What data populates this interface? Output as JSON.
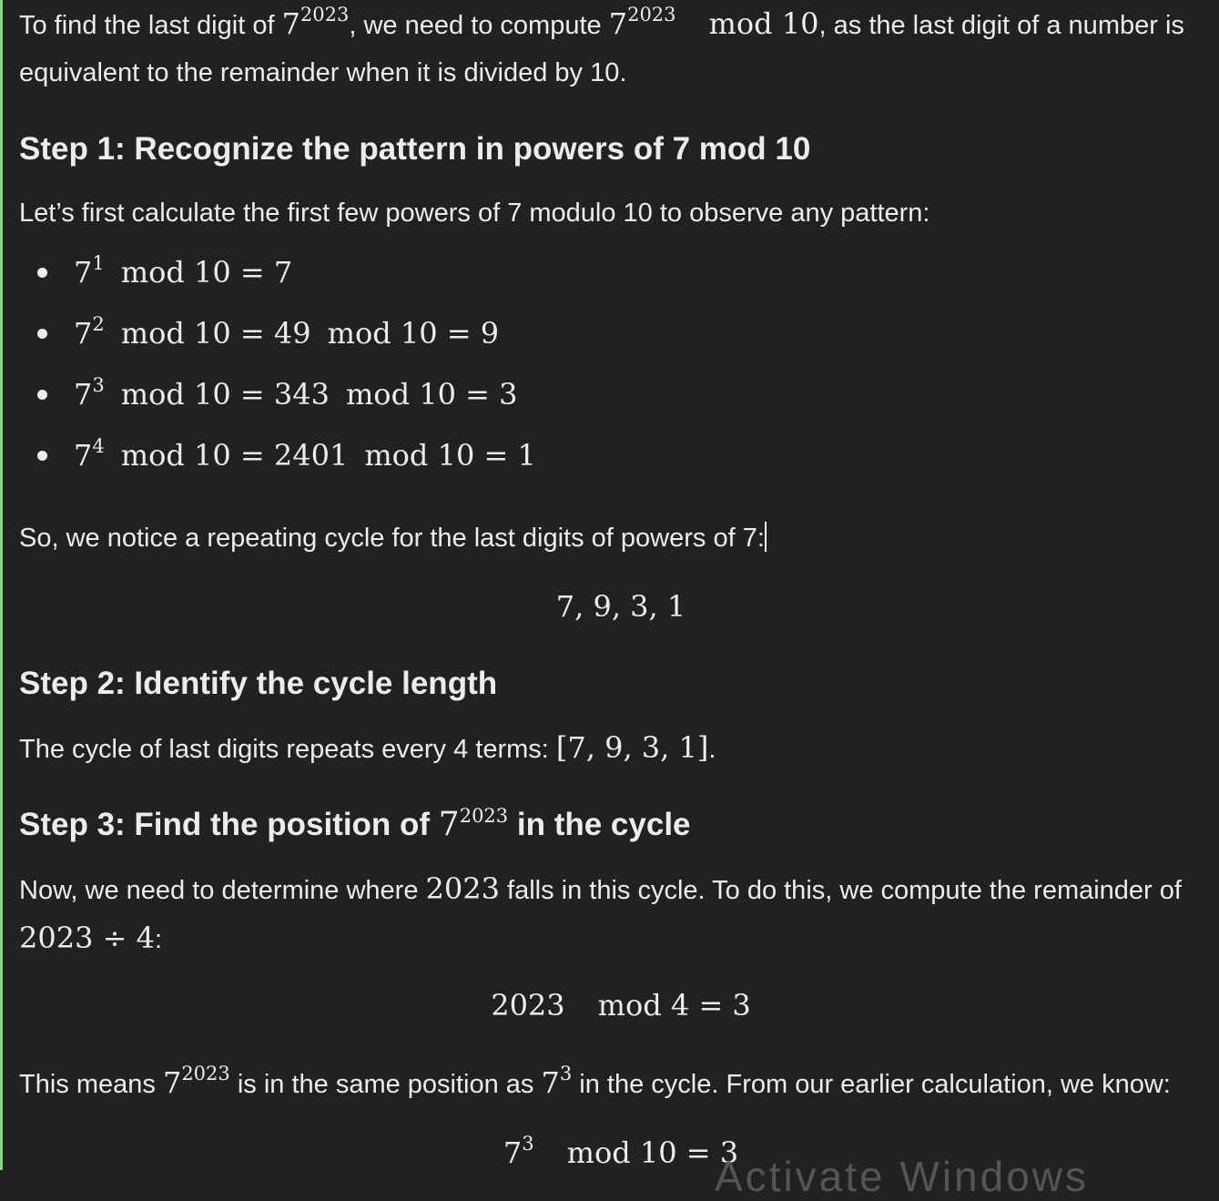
{
  "intro": {
    "p1": "To find the last digit of ",
    "m1_base": "7",
    "m1_exp": "2023",
    "p2": ", we need to compute ",
    "m2_base": "7",
    "m2_exp": "2023",
    "m2_rest": "mod 10",
    "p3": ", as the last digit of a number is",
    "line2": "equivalent to the remainder when it is divided by 10."
  },
  "step1": {
    "heading": "Step 1: Recognize the pattern in powers of 7 mod 10",
    "text": "Let’s first calculate the first few powers of 7 modulo 10 to observe any pattern:",
    "items": [
      {
        "base": "7",
        "exp": "1",
        "expr": "mod 10 = 7"
      },
      {
        "base": "7",
        "exp": "2",
        "expr": "mod 10 = 49",
        "expr2": "mod 10 = 9"
      },
      {
        "base": "7",
        "exp": "3",
        "expr": "mod 10 = 343",
        "expr2": "mod 10 = 3"
      },
      {
        "base": "7",
        "exp": "4",
        "expr": "mod 10 = 2401",
        "expr2": "mod 10 = 1"
      }
    ],
    "notice": "So, we notice a repeating cycle for the last digits of powers of 7:",
    "cycle_display": "7, 9, 3, 1"
  },
  "step2": {
    "heading": "Step 2: Identify the cycle length",
    "text": "The cycle of last digits repeats every 4 terms: ",
    "cycle_inline": "[7, 9, 3, 1]",
    "end": "."
  },
  "step3": {
    "heading_pre": "Step 3: Find the position of ",
    "heading_base": "7",
    "heading_exp": "2023",
    "heading_post": " in the cycle",
    "text1_a": "Now, we need to determine where ",
    "text1_m": "2023",
    "text1_b": " falls in this cycle. To do this, we compute the remainder of",
    "text2_m": "2023 ÷ 4",
    "text2_end": ":",
    "display_a": "2023",
    "display_b": "mod 4 = 3",
    "means_a": "This means ",
    "means_base": "7",
    "means_exp": "2023",
    "means_b": " is in the same position as ",
    "means_base2": "7",
    "means_exp2": "3",
    "means_c": " in the cycle. From our earlier calculation, we know:",
    "final_base": "7",
    "final_exp": "3",
    "final_expr": "mod 10 = 3"
  },
  "watermark": "Activate Windows"
}
